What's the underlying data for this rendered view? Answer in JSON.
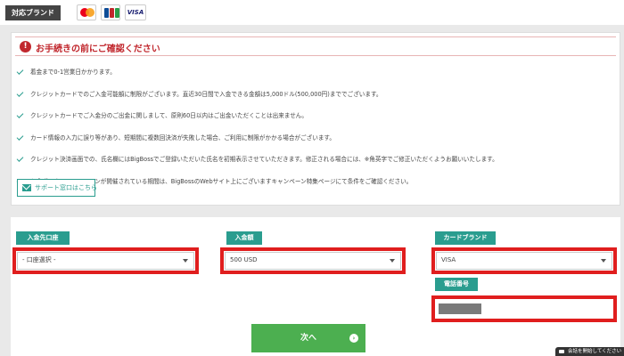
{
  "brands": {
    "label": "対応ブランド",
    "cards": [
      "mastercard",
      "jcb",
      "visa"
    ],
    "visa_text": "VISA"
  },
  "notice": {
    "title": "お手続きの前にご確認ください",
    "items": [
      "着金まで0-1営業日かかります。",
      "クレジットカードでのご入金可能額に制限がございます。直近30日間で入金できる金額は5,000ドル(500,000円)まででございます。",
      "クレジットカードでご入金分のご出金に関しまして、原則60日以内はご出金いただくことは出来ません。",
      "カード情報の入力に誤り等があり、短期間に複数回決済が失敗した場合、ご利用に制限がかかる場合がございます。",
      "クレジット決済画面での、氏名欄にはBigBossでご登録いただいた氏名を初期表示させていただきます。修正される場合には、※角英字でご修正いただくようお願いいたします。",
      "入金ボーナスキャンペーンが開催されている期間は、BigBossのWebサイト上にございますキャンペーン特集ページにて条件をご確認ください。"
    ],
    "support_label": "サポート窓口はこちら"
  },
  "form": {
    "account": {
      "label": "入金先口座",
      "value": "- 口座選択 -"
    },
    "amount": {
      "label": "入金額",
      "value": "500 USD"
    },
    "brand": {
      "label": "カードブランド",
      "value": "VISA"
    },
    "phone": {
      "label": "電話番号"
    },
    "next_label": "次へ"
  },
  "chat": {
    "label": "会話を開始してください"
  },
  "colors": {
    "accent": "#2a9d8f",
    "highlight": "#e01e1e",
    "alert": "#c1272d",
    "button": "#4caf50"
  }
}
